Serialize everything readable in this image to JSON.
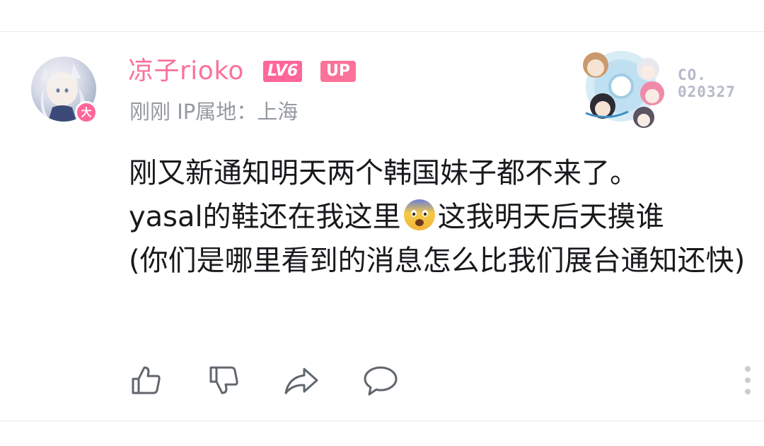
{
  "user": {
    "name": "凉子rioko",
    "level_badge": "LV6",
    "up_badge": "UP",
    "avatar_badge": "大",
    "meta": "刚刚 IP属地：上海"
  },
  "decoration": {
    "code_line1": "CO.",
    "code_line2": "020327"
  },
  "comment": {
    "line1": "刚又新通知明天两个韩国妹子都不来了。",
    "line2_before_emoji": "yasal的鞋还在我这里",
    "emoji": "fearful-face-emoji",
    "line2_after_emoji": "这我明天后天摸谁",
    "line3": "(你们是哪里看到的消息怎么比我们展台通知还快)"
  },
  "actions": {
    "like": "thumbs-up-icon",
    "dislike": "thumbs-down-icon",
    "share": "share-icon",
    "reply": "comment-icon",
    "more": "more-vertical-icon"
  },
  "colors": {
    "username": "#fb7299",
    "badge": "#ff6699",
    "meta": "#9499a0",
    "text": "#18191c",
    "icon": "#61666d"
  }
}
